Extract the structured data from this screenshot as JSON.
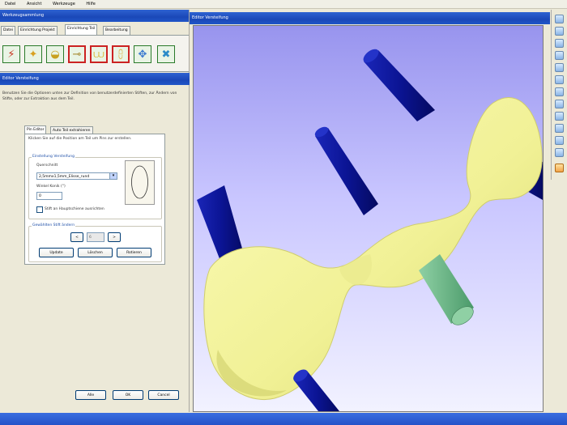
{
  "menu": [
    "Datei",
    "Ansicht",
    "Werkzeuge",
    "Hilfe"
  ],
  "left_panel": {
    "title": "Werkzeugsammlung",
    "tabs": [
      "Datei",
      "Einrichtung Projekt",
      "Einrichtung Teil",
      "Bearbeitung"
    ],
    "active_tab": 2,
    "tools": [
      {
        "icon": "lightning-tool-icon",
        "glyph": "⚡"
      },
      {
        "icon": "jaw-tool-icon",
        "glyph": "🦷"
      },
      {
        "icon": "bowl-tool-icon",
        "glyph": "◒"
      },
      {
        "icon": "connect-tool-icon",
        "glyph": "⊸"
      },
      {
        "icon": "teeth-tool-icon",
        "glyph": "⩊"
      },
      {
        "icon": "teeth-pins-tool-icon",
        "glyph": "⩉"
      },
      {
        "icon": "move-tool-icon",
        "glyph": "✥"
      },
      {
        "icon": "delete-tool-icon",
        "glyph": "✖"
      }
    ],
    "section_title": "Editor Versteifung",
    "description": "Benutzen Sie die Optionen unten zur Definition von benutzerdefinierten Stiften, zur Ändern von Stifte, oder zur Extraktion aus dem Teil.",
    "inner_tabs": [
      "Pin Editor",
      "Auto Teil extrahieren"
    ],
    "instruction": "Klicken Sie auf die Position am Teil um Pins zur erstellen.",
    "group_setup": {
      "title": "Einstellung Versteifung",
      "cross_section_label": "Querschnitt",
      "cross_section_value": "2,5mmx1,5mm_Elisse_rund",
      "angle_label": "Winkel Konik (°)",
      "angle_value": "0",
      "checkbox_label": "Stift an Hauptschiene ausrichten"
    },
    "group_selected": {
      "title": "Gewählten Stift ändern",
      "prev": "<",
      "index": "6",
      "next": ">",
      "update": "Update",
      "delete": "Löschen",
      "rotate": "Rotieren"
    },
    "buttons": {
      "apply": "Alle",
      "ok": "OK",
      "cancel": "Cancel"
    }
  },
  "right_panel": {
    "title": "Editor Versteifung"
  },
  "colors": {
    "model": "#f3f39a",
    "pin": "#0a1490",
    "selected_pin": "#6db88a",
    "title_bar": "#1f52c5"
  }
}
